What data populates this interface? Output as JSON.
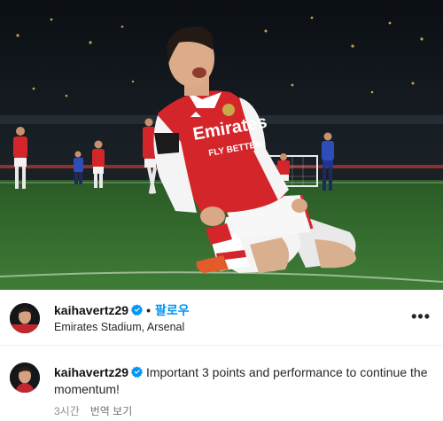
{
  "post": {
    "username": "kaihavertz29",
    "verified": true,
    "follow_label": "팔로우",
    "separator": "•",
    "location": "Emirates Stadium, Arsenal",
    "more_label": "•••"
  },
  "photo": {
    "sponsor_line1": "Emirates",
    "sponsor_line2": "FLY BETTER"
  },
  "caption": {
    "username": "kaihavertz29",
    "text": "Important 3 points and performance to continue the momentum!",
    "timestamp": "3시간",
    "translate_label": "번역 보기"
  },
  "colors": {
    "kit_red": "#d4252b",
    "verified_blue": "#0095f6",
    "follow_blue": "#0095f6",
    "pitch_green": "#3a7434"
  }
}
